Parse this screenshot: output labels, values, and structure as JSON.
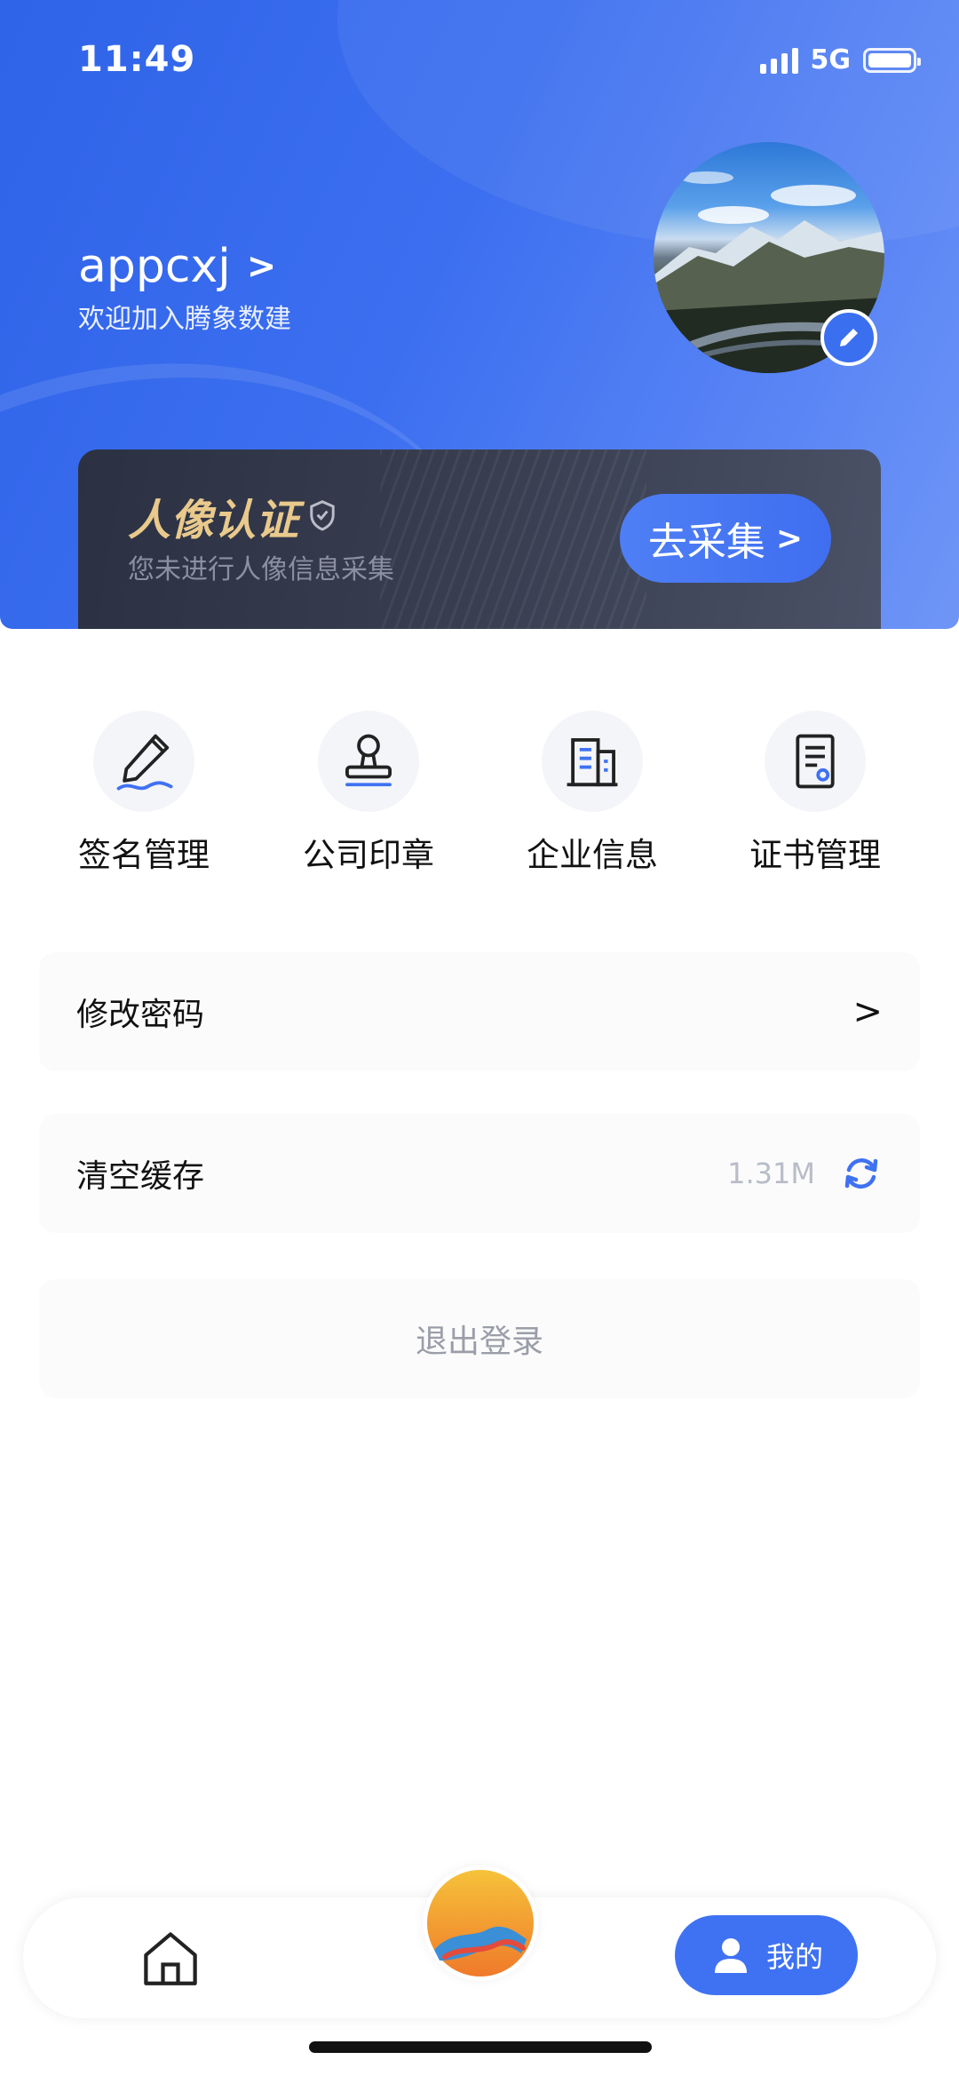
{
  "status_bar": {
    "time": "11:49",
    "network": "5G"
  },
  "profile": {
    "username": "appcxj",
    "username_chevron": ">",
    "welcome": "欢迎加入腾象数建"
  },
  "face_verification": {
    "title": "人像认证",
    "subtitle": "您未进行人像信息采集",
    "button_label": "去采集",
    "button_chevron": ">"
  },
  "quick_actions": [
    {
      "label": "签名管理",
      "icon": "signature-pen-icon"
    },
    {
      "label": "公司印章",
      "icon": "stamp-icon"
    },
    {
      "label": "企业信息",
      "icon": "building-icon"
    },
    {
      "label": "证书管理",
      "icon": "certificate-icon"
    }
  ],
  "settings": {
    "change_password": {
      "label": "修改密码",
      "chevron": ">"
    },
    "clear_cache": {
      "label": "清空缓存",
      "value": "1.31M",
      "icon": "refresh-icon"
    },
    "logout": {
      "label": "退出登录"
    }
  },
  "bottom_nav": {
    "home": {
      "icon": "home-icon"
    },
    "center": {
      "icon": "app-logo-icon"
    },
    "me": {
      "label": "我的",
      "icon": "user-icon"
    }
  },
  "colors": {
    "accent": "#3f72f2",
    "gold": "#e9c98c",
    "card_dark": "#2b3142"
  }
}
